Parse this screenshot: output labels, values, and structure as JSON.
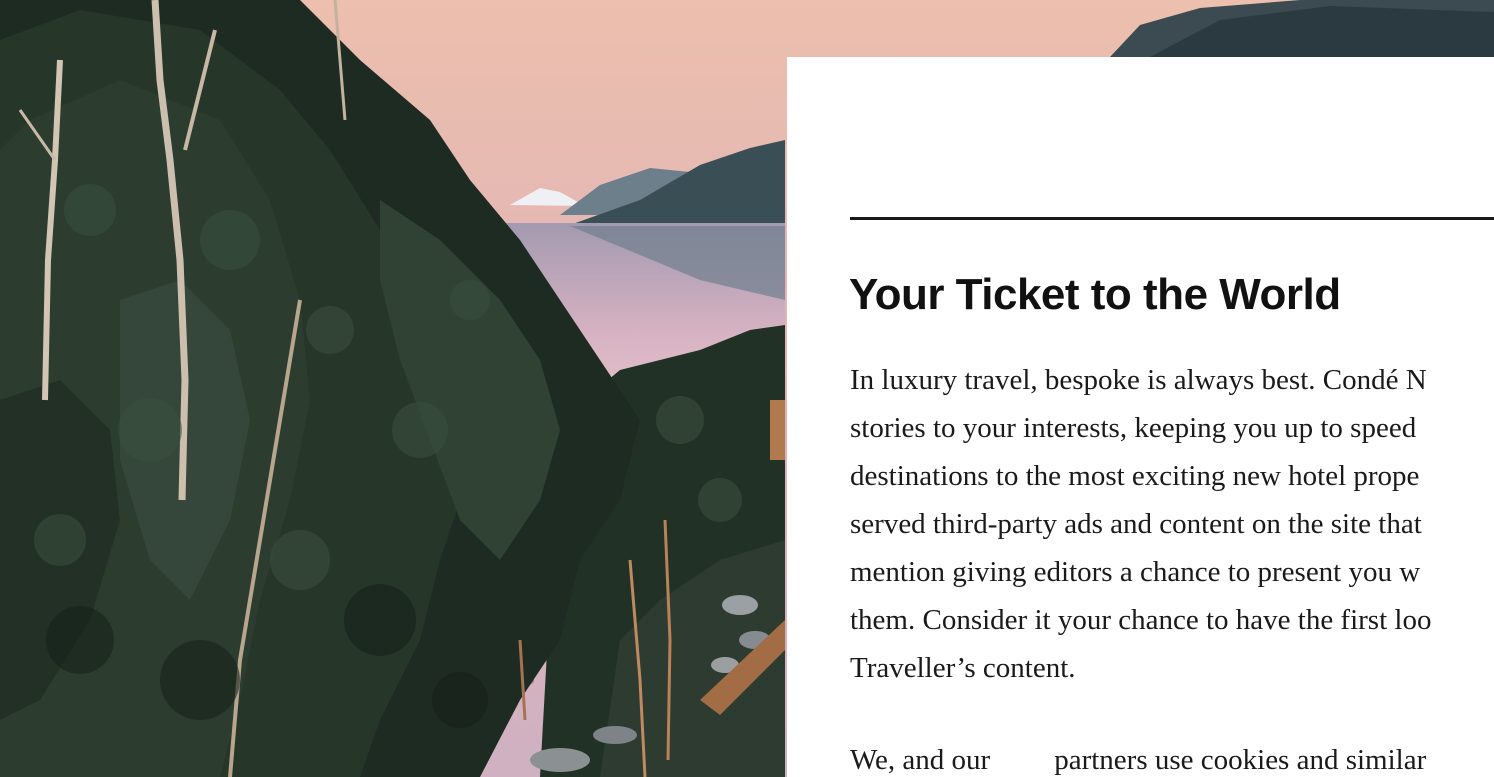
{
  "modal": {
    "title": "Your Ticket to the World",
    "body_lines": [
      "In luxury travel, bespoke is always best. Condé N",
      "stories to your interests, keeping you up to speed",
      "destinations to the most exciting new hotel prope",
      "served third-party ads and content on the site that",
      "mention giving editors a chance to present you w",
      "them. Consider it your chance to have the first loo",
      "Traveller’s content."
    ],
    "cookie_text_start": "We, and our",
    "cookie_text_rest": "partners use cookies and similar"
  },
  "colors": {
    "modal_background": "#ffffff",
    "text": "#1a1a1a",
    "sky": "#e2b4b3",
    "forest": "#1f2e22"
  }
}
